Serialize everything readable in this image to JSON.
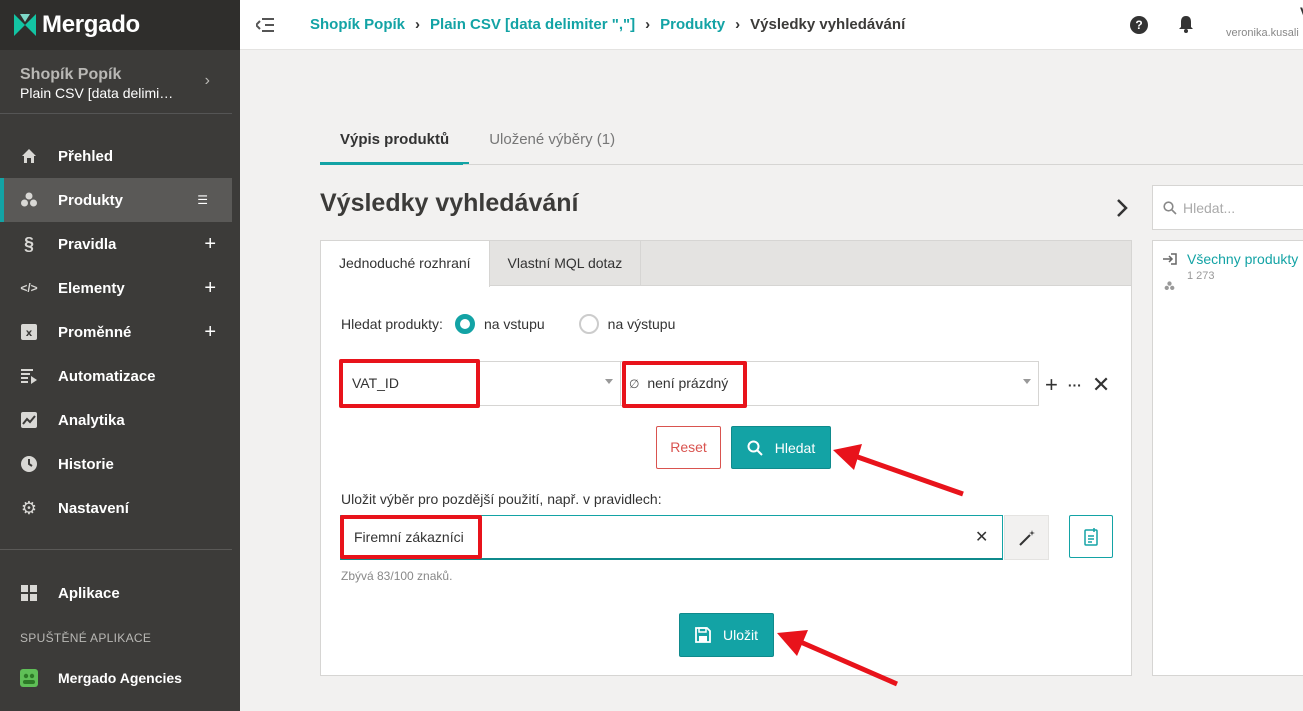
{
  "app": {
    "logo": "Mergado"
  },
  "project": {
    "name": "Shopík Popík",
    "feed": "Plain CSV [data delimi…"
  },
  "nav": {
    "items": [
      {
        "label": "Přehled",
        "icon": "home-icon"
      },
      {
        "label": "Produkty",
        "icon": "boxes-icon",
        "active": true
      },
      {
        "label": "Pravidla",
        "icon": "section-icon"
      },
      {
        "label": "Elementy",
        "icon": "code-icon"
      },
      {
        "label": "Proměnné",
        "icon": "variable-icon"
      },
      {
        "label": "Automatizace",
        "icon": "automation-icon"
      },
      {
        "label": "Analytika",
        "icon": "chart-icon"
      },
      {
        "label": "Historie",
        "icon": "clock-icon"
      },
      {
        "label": "Nastavení",
        "icon": "gear-icon"
      }
    ],
    "apps_label": "Aplikace",
    "running_apps_label": "SPUŠTĚNÉ APLIKACE",
    "running_app": "Mergado Agencies"
  },
  "breadcrumb": [
    "Shopík Popík",
    "Plain CSV [data delimiter \",\"]",
    "Produkty",
    "Výsledky vyhledávání"
  ],
  "user": {
    "email": "veronika.kusali",
    "initial": "V"
  },
  "tabs": [
    "Výpis produktů",
    "Uložené výběry (1)"
  ],
  "page_title": "Výsledky vyhledávání",
  "panel": {
    "tabs": [
      "Jednoduché rozhraní",
      "Vlastní MQL dotaz"
    ],
    "search_for_label": "Hledat produkty:",
    "radio": [
      "na vstupu",
      "na výstupu"
    ],
    "condition": {
      "field": "VAT_ID",
      "operator": "není prázdný",
      "operator_symbol": "∅"
    },
    "reset": "Reset",
    "search": "Hledat",
    "save_label": "Uložit výběr pro pozdější použití, např. v pravidlech:",
    "save_value": "Firemní zákazníci",
    "remaining": "Zbývá 83/100 znaků.",
    "save_button": "Uložit"
  },
  "sidebar_right": {
    "search_placeholder": "Hledat...",
    "all_products": "Všechny produkty",
    "count": "1 273"
  },
  "colors": {
    "accent": "#13a3a5",
    "sidebar": "#3c3b39",
    "annotation": "#e8131b"
  }
}
